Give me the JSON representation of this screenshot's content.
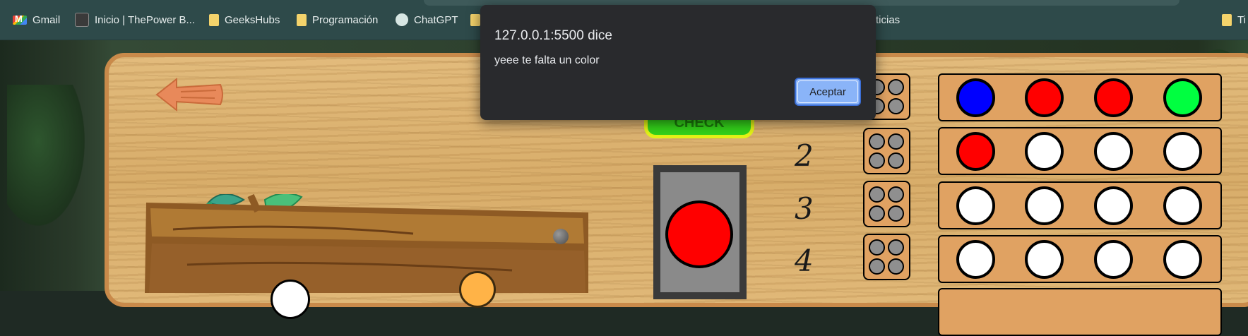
{
  "bookmarks": [
    {
      "label": "Gmail",
      "icon": "gmail-icon"
    },
    {
      "label": "Inicio | ThePower B...",
      "icon": "thepower-icon"
    },
    {
      "label": "GeeksHubs",
      "icon": "folder-icon"
    },
    {
      "label": "Programación",
      "icon": "folder-icon"
    },
    {
      "label": "ChatGPT",
      "icon": "chatgpt-icon"
    },
    {
      "label": "ticias",
      "icon": "folder-icon"
    },
    {
      "label": "Ti",
      "icon": "folder-icon"
    }
  ],
  "game": {
    "check_label": "CHECK",
    "selected_color": "#ff0000",
    "row_numbers": [
      "2",
      "3",
      "4"
    ],
    "rows": [
      {
        "pegs": [
          "#0000ff",
          "#ff0000",
          "#ff0000",
          "#00ff40"
        ]
      },
      {
        "pegs": [
          "#ff0000",
          "#ffffff",
          "#ffffff",
          "#ffffff"
        ]
      },
      {
        "pegs": [
          "#ffffff",
          "#ffffff",
          "#ffffff",
          "#ffffff"
        ]
      },
      {
        "pegs": [
          "#ffffff",
          "#ffffff",
          "#ffffff",
          "#ffffff"
        ]
      }
    ]
  },
  "alert": {
    "title": "127.0.0.1:5500 dice",
    "message": "yeee te falta un color",
    "button_label": "Aceptar"
  },
  "colors": {
    "board_border": "#c98a4a",
    "row_bg": "#e0a262",
    "alert_bg": "#292a2d",
    "alert_button": "#8ab4f8"
  }
}
